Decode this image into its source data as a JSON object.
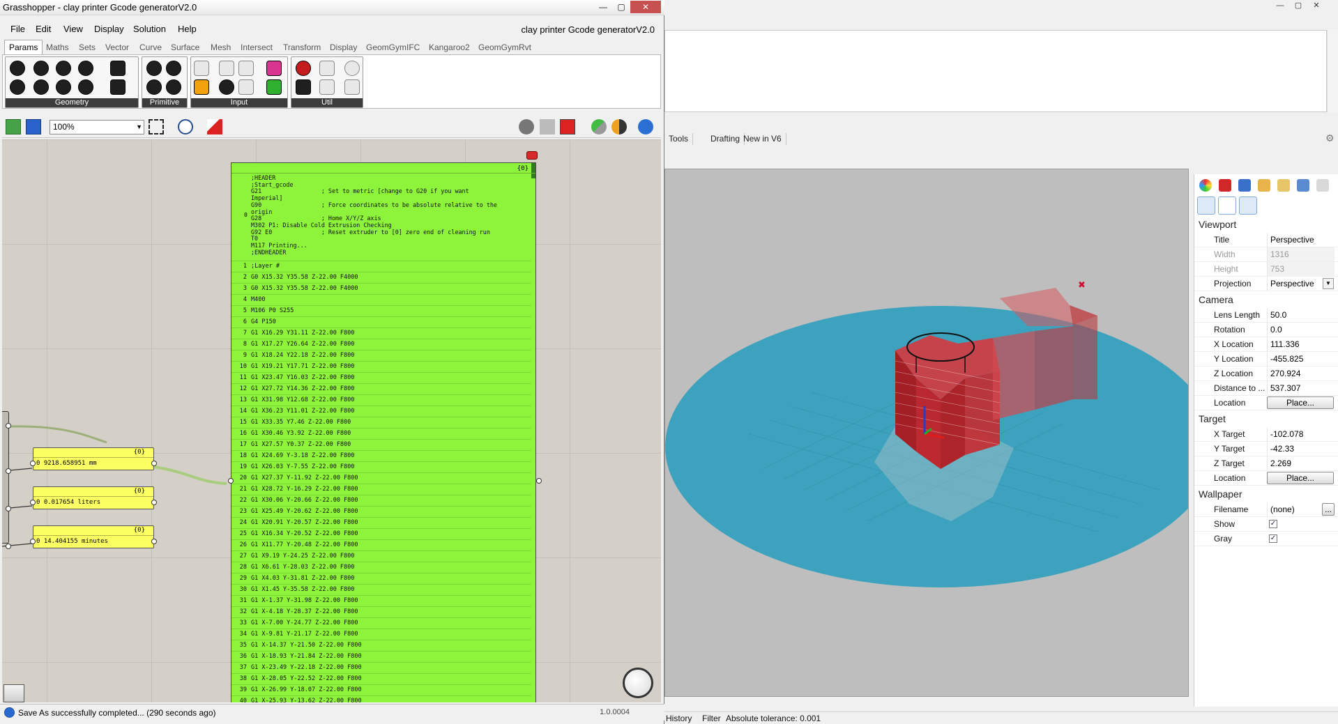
{
  "rhino": {
    "tabs": [
      "Tools",
      "Drafting",
      "New in V6"
    ],
    "viewport_props": {
      "viewport_section": "Viewport",
      "title_label": "Title",
      "title_value": "Perspective",
      "width_label": "Width",
      "width_value": "1316",
      "height_label": "Height",
      "height_value": "753",
      "projection_label": "Projection",
      "projection_value": "Perspective",
      "camera_section": "Camera",
      "lens_label": "Lens Length",
      "lens_value": "50.0",
      "rotation_label": "Rotation",
      "rotation_value": "0.0",
      "xloc_label": "X Location",
      "xloc_value": "111.336",
      "yloc_label": "Y Location",
      "yloc_value": "-455.825",
      "zloc_label": "Z Location",
      "zloc_value": "270.924",
      "dist_label": "Distance to ...",
      "dist_value": "537.307",
      "location_label": "Location",
      "place_label": "Place...",
      "target_section": "Target",
      "xt_label": "X Target",
      "xt_value": "-102.078",
      "yt_label": "Y Target",
      "yt_value": "-42.33",
      "zt_label": "Z Target",
      "zt_value": "2.269",
      "tlocation_label": "Location",
      "tplace_label": "Place...",
      "wallpaper_section": "Wallpaper",
      "filename_label": "Filename",
      "filename_value": "(none)",
      "browse_label": "...",
      "show_label": "Show",
      "gray_label": "Gray"
    },
    "status": {
      "history": "History",
      "filter": "Filter",
      "tolerance": "Absolute tolerance: 0.001"
    }
  },
  "gh": {
    "window_title": "Grasshopper - clay printer Gcode generatorV2.0",
    "doc_title": "clay printer Gcode generatorV2.0",
    "menu": [
      "File",
      "Edit",
      "View",
      "Display",
      "Solution",
      "Help"
    ],
    "categories": [
      "Params",
      "Maths",
      "Sets",
      "Vector",
      "Curve",
      "Surface",
      "Mesh",
      "Intersect",
      "Transform",
      "Display",
      "GeomGymIFC",
      "Kangaroo2",
      "GeomGymRvt"
    ],
    "ribbon_groups": [
      "Geometry",
      "Primitive",
      "Input",
      "Util"
    ],
    "zoom": "100%",
    "panels": [
      {
        "tag": "{0}",
        "index": "0",
        "value": "9218.658951 mm"
      },
      {
        "tag": "{0}",
        "index": "0",
        "value": "0.017654 liters"
      },
      {
        "tag": "{0}",
        "index": "0",
        "value": "14.404155 minutes"
      }
    ],
    "gcode": {
      "tag": "{0}",
      "header_index": "0",
      "header": ";HEADER\n;Start_gcode\nG21                 ; Set to metric [change to G20 if you want\nImperial]\nG90                 ; Force coordinates to be absolute relative to the\norigin\nG28                 ; Home X/Y/Z axis\nM302 P1: Disable Cold Extrusion Checking\nG92 E0              ; Reset extruder to [0] zero end of cleaning run\nT0\nM117 Printing...\n;ENDHEADER",
      "lines": [
        [
          "1",
          ";Layer #"
        ],
        [
          "2",
          "G0 X15.32 Y35.58 Z-22.00 F4000"
        ],
        [
          "3",
          "G0 X15.32 Y35.58 Z-22.00 F4000"
        ],
        [
          "4",
          "M400"
        ],
        [
          "5",
          "M106 P0 S255"
        ],
        [
          "6",
          "G4 P150"
        ],
        [
          "7",
          "G1 X16.29 Y31.11 Z-22.00 F800"
        ],
        [
          "8",
          "G1 X17.27 Y26.64 Z-22.00 F800"
        ],
        [
          "9",
          "G1 X18.24 Y22.18 Z-22.00 F800"
        ],
        [
          "10",
          "G1 X19.21 Y17.71 Z-22.00 F800"
        ],
        [
          "11",
          "G1 X23.47 Y16.03 Z-22.00 F800"
        ],
        [
          "12",
          "G1 X27.72 Y14.36 Z-22.00 F800"
        ],
        [
          "13",
          "G1 X31.98 Y12.68 Z-22.00 F800"
        ],
        [
          "14",
          "G1 X36.23 Y11.01 Z-22.00 F800"
        ],
        [
          "15",
          "G1 X33.35 Y7.46 Z-22.00 F800"
        ],
        [
          "16",
          "G1 X30.46 Y3.92 Z-22.00 F800"
        ],
        [
          "17",
          "G1 X27.57 Y0.37 Z-22.00 F800"
        ],
        [
          "18",
          "G1 X24.69 Y-3.18 Z-22.00 F800"
        ],
        [
          "19",
          "G1 X26.03 Y-7.55 Z-22.00 F800"
        ],
        [
          "20",
          "G1 X27.37 Y-11.92 Z-22.00 F800"
        ],
        [
          "21",
          "G1 X28.72 Y-16.29 Z-22.00 F800"
        ],
        [
          "22",
          "G1 X30.06 Y-20.66 Z-22.00 F800"
        ],
        [
          "23",
          "G1 X25.49 Y-20.62 Z-22.00 F800"
        ],
        [
          "24",
          "G1 X20.91 Y-20.57 Z-22.00 F800"
        ],
        [
          "25",
          "G1 X16.34 Y-20.52 Z-22.00 F800"
        ],
        [
          "26",
          "G1 X11.77 Y-20.48 Z-22.00 F800"
        ],
        [
          "27",
          "G1 X9.19 Y-24.25 Z-22.00 F800"
        ],
        [
          "28",
          "G1 X6.61 Y-28.03 Z-22.00 F800"
        ],
        [
          "29",
          "G1 X4.03 Y-31.81 Z-22.00 F800"
        ],
        [
          "30",
          "G1 X1.45 Y-35.58 Z-22.00 F800"
        ],
        [
          "31",
          "G1 X-1.37 Y-31.98 Z-22.00 F800"
        ],
        [
          "32",
          "G1 X-4.18 Y-28.37 Z-22.00 F800"
        ],
        [
          "33",
          "G1 X-7.00 Y-24.77 Z-22.00 F800"
        ],
        [
          "34",
          "G1 X-9.81 Y-21.17 Z-22.00 F800"
        ],
        [
          "35",
          "G1 X-14.37 Y-21.50 Z-22.00 F800"
        ],
        [
          "36",
          "G1 X-18.93 Y-21.84 Z-22.00 F800"
        ],
        [
          "37",
          "G1 X-23.49 Y-22.18 Z-22.00 F800"
        ],
        [
          "38",
          "G1 X-28.05 Y-22.52 Z-22.00 F800"
        ],
        [
          "39",
          "G1 X-26.99 Y-18.07 Z-22.00 F800"
        ],
        [
          "40",
          "G1 X-25.93 Y-13.62 Z-22.00 F800"
        ]
      ]
    },
    "status": "Save As successfully completed... (290 seconds ago)",
    "version": "1.0.0004"
  },
  "colors": {
    "gcode_panel": "#8ef33b",
    "data_panel": "#fcff62",
    "viewport_bg": "#bebebe",
    "ground_disc": "#3da2bd",
    "model": "#c0272d"
  }
}
